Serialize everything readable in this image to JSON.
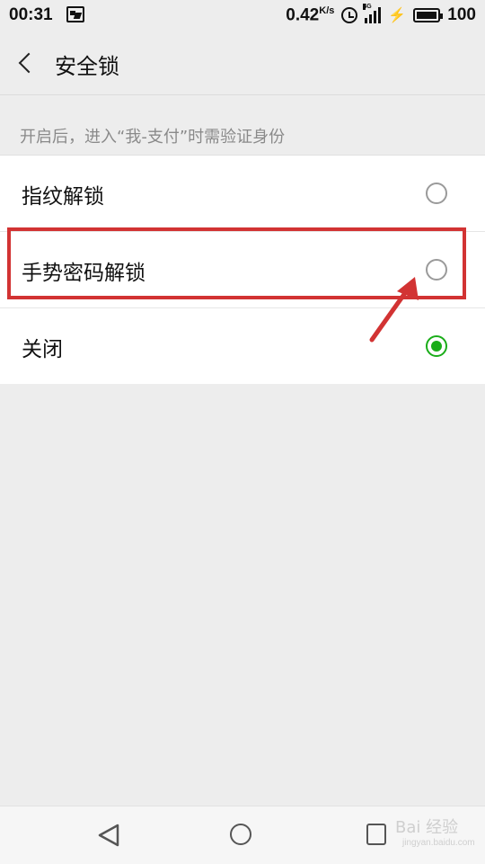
{
  "status_bar": {
    "time": "00:31",
    "net_speed": "0.42",
    "net_speed_unit": "K/s",
    "network_type": "4G",
    "battery": "100"
  },
  "header": {
    "title": "安全锁",
    "back_icon": "chevron-left-icon"
  },
  "hint": "开启后，进入“我-支付”时需验证身份",
  "options": [
    {
      "label": "指纹解锁",
      "selected": false
    },
    {
      "label": "手势密码解锁",
      "selected": false
    },
    {
      "label": "关闭",
      "selected": true
    }
  ],
  "accent_color": "#1aad19",
  "annotation_color": "#d23333",
  "watermark": {
    "text": "Bai 经验",
    "sub": "jingyan.baidu.com"
  }
}
